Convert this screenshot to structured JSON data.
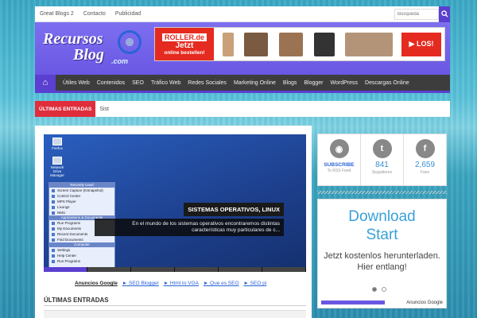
{
  "topbar": {
    "links": [
      "Great Blogs 2",
      "Contacto",
      "Publicidad"
    ],
    "search_placeholder": "Búsqueda"
  },
  "logo": {
    "line1": "Recursos",
    "line2": "Blog",
    ".com": ".com"
  },
  "ad": {
    "brand": "ROLLER.de",
    "line1": "Jetzt",
    "line2": "online bestellen!",
    "cta": "▶ LOS!"
  },
  "nav": {
    "items": [
      "Útiles Web",
      "Contenidos",
      "SEO",
      "Tráfico Web",
      "Redes Sociales",
      "Marketing Online",
      "Blogs",
      "Blogger",
      "WordPress",
      "Descargas Online"
    ]
  },
  "ticker": {
    "label": "ÚLTIMAS ENTRADAS",
    "text": "Sist"
  },
  "slider": {
    "desktop_icons": [
      "Firefox",
      "Network Drive Manager"
    ],
    "menu_header": "Recently Used",
    "menu_items": [
      "Screen Capture (KSnapshot)",
      "Control Center",
      "MPS Player",
      "Lixongs",
      "NMU"
    ],
    "menu_section": "Applications & Documents",
    "menu_items2": [
      "Run Programs",
      "My Documents",
      "Recent Documents",
      "Find Documents"
    ],
    "menu_section2": "Computer",
    "menu_items3": [
      "Settings",
      "Help Center",
      "Run Programs"
    ],
    "title": "SISTEMAS OPERATIVOS, LINUX",
    "desc": "En el mundo de los sistemas operativos encontraremos distintas características muy particulares de c..."
  },
  "adlinks": {
    "label": "Anuncios Google",
    "links": [
      "► SEO Blogger",
      "► Html to VGA",
      "► Que es SEO",
      "► SEO pi"
    ]
  },
  "section_title": "ÚLTIMAS ENTRADAS",
  "social": [
    {
      "icon": "rss-icon",
      "glyph": "◉",
      "count": "SUBSCRIBE",
      "sub": "To RSS Feed"
    },
    {
      "icon": "twitter-icon",
      "glyph": "t",
      "count": "841",
      "sub": "Seguidores"
    },
    {
      "icon": "facebook-icon",
      "glyph": "f",
      "count": "2,659",
      "sub": "Fans"
    }
  ],
  "gad": {
    "headline_1": "Download",
    "headline_2": "Start",
    "text": "Jetzt kostenlos herunterladen. Hier entlang!",
    "adsby": "Anuncios Google"
  },
  "colors": {
    "accent": "#5b3fd0",
    "ticker": "#e02d3c",
    "header": "#6a57e3"
  }
}
